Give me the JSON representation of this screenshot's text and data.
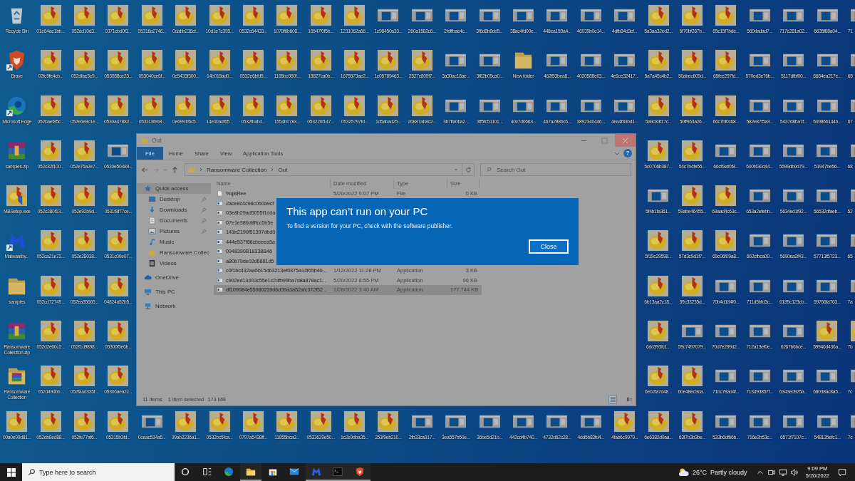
{
  "desktop": {
    "rows": [
      {
        "segments": [
          [
            {
              "kind": "recycle",
              "label": "Recycle Bin"
            },
            {
              "kind": "bird",
              "label": "01e64ae1bb..."
            },
            {
              "kind": "bird",
              "label": "052dd10d3..."
            },
            {
              "kind": "bird",
              "label": "0371cbd0f3..."
            },
            {
              "kind": "bird",
              "label": "05316a2746..."
            },
            {
              "kind": "bird",
              "label": "0dabb236cf..."
            },
            {
              "kind": "bird",
              "label": "10d1e7c399..."
            },
            {
              "kind": "bird",
              "label": "0532c64433..."
            },
            {
              "kind": "bird",
              "label": "1078f6b608..."
            },
            {
              "kind": "bird",
              "label": "16547f0f5b..."
            },
            {
              "kind": "bird",
              "label": "1231062a66..."
            },
            {
              "kind": "window",
              "label": "1c98450a33..."
            },
            {
              "kind": "window",
              "label": "260a1582c6..."
            },
            {
              "kind": "window",
              "label": "2fdffbae4c..."
            },
            {
              "kind": "window",
              "label": "3f6d8b8dd5..."
            },
            {
              "kind": "window",
              "label": "38ac4fd00e..."
            },
            {
              "kind": "window",
              "label": "448ea159a4..."
            },
            {
              "kind": "window",
              "label": "46039b0e14..."
            },
            {
              "kind": "window",
              "label": "4dfb84d3cf..."
            },
            {
              "kind": "bird",
              "label": "5a3aa32ed2..."
            },
            {
              "kind": "bird",
              "label": "6f70bf287b..."
            },
            {
              "kind": "bird",
              "label": "65c15f7bde..."
            },
            {
              "kind": "window",
              "label": "569dadad7..."
            },
            {
              "kind": "window",
              "label": "717e281a02..."
            },
            {
              "kind": "window",
              "label": "6635f88a04..."
            },
            {
              "kind": "window",
              "label": "71"
            }
          ]
        ]
      },
      {
        "segments": [
          [
            {
              "kind": "brave",
              "label": "Brave"
            },
            {
              "kind": "bird",
              "label": "02fc9fe4cb..."
            },
            {
              "kind": "bird",
              "label": "052dfae3c9..."
            },
            {
              "kind": "bird",
              "label": "053088ce23..."
            },
            {
              "kind": "bird",
              "label": "053040ce6f..."
            },
            {
              "kind": "bird",
              "label": "0e5433f300..."
            },
            {
              "kind": "bird",
              "label": "14b015ad0..."
            },
            {
              "kind": "bird",
              "label": "0532e6bfd5..."
            },
            {
              "kind": "bird",
              "label": "1165bc950f..."
            },
            {
              "kind": "bird",
              "label": "18827ca0b..."
            },
            {
              "kind": "bird",
              "label": "1675573ae2..."
            },
            {
              "kind": "bird",
              "label": "1c05789463..."
            },
            {
              "kind": "bird",
              "label": "2527c809f7..."
            },
            {
              "kind": "window",
              "label": "3a30ac18ae..."
            },
            {
              "kind": "window",
              "label": "3f62b09ca0..."
            },
            {
              "kind": "folder",
              "label": "New folder"
            },
            {
              "kind": "window",
              "label": "462f53bea8..."
            },
            {
              "kind": "window",
              "label": "4020588e03..."
            },
            {
              "kind": "window",
              "label": "4e6ce32417..."
            },
            {
              "kind": "bird",
              "label": "5a7a45c4b2..."
            },
            {
              "kind": "bird",
              "label": "50abec609d..."
            },
            {
              "kind": "bird",
              "label": "65fee297fd..."
            },
            {
              "kind": "window",
              "label": "570ed3e76b..."
            },
            {
              "kind": "window",
              "label": "5117dfbf00..."
            },
            {
              "kind": "window",
              "label": "6684ea217e..."
            },
            {
              "kind": "window",
              "label": "65"
            }
          ]
        ]
      },
      {
        "segments": [
          [
            {
              "kind": "edge",
              "label": "Microsoft Edge"
            },
            {
              "kind": "bird",
              "label": "052baef85c..."
            },
            {
              "kind": "bird",
              "label": "052e6e8c1e..."
            },
            {
              "kind": "bird",
              "label": "0530a47882..."
            },
            {
              "kind": "bird",
              "label": "053113feb8..."
            },
            {
              "kind": "bird",
              "label": "0e6991f6c5..."
            },
            {
              "kind": "bird",
              "label": "14e00adf65..."
            },
            {
              "kind": "bird",
              "label": "0532fbabd..."
            },
            {
              "kind": "bird",
              "label": "1554b0783..."
            },
            {
              "kind": "bird",
              "label": "053226f147..."
            },
            {
              "kind": "bird",
              "label": "05325797fd..."
            },
            {
              "kind": "bird",
              "label": "1d5abad25..."
            },
            {
              "kind": "bird",
              "label": "26887ab8d2..."
            },
            {
              "kind": "window",
              "label": "3b7ffa0ba2..."
            },
            {
              "kind": "window",
              "label": "3ff5fc51101..."
            },
            {
              "kind": "window",
              "label": "40c7d0663..."
            },
            {
              "kind": "window",
              "label": "467a288bc6..."
            },
            {
              "kind": "window",
              "label": "38923404d6..."
            },
            {
              "kind": "window",
              "label": "4ea4f83bd1..."
            },
            {
              "kind": "bird",
              "label": "5a9c83f17c..."
            },
            {
              "kind": "bird",
              "label": "50ff963a26..."
            },
            {
              "kind": "bird",
              "label": "66c7bf0c68..."
            },
            {
              "kind": "window",
              "label": "582e87f5a3..."
            },
            {
              "kind": "window",
              "label": "5437d8ba7f..."
            },
            {
              "kind": "window",
              "label": "50986b144b..."
            },
            {
              "kind": "window",
              "label": "67"
            }
          ]
        ]
      },
      {
        "segments": [
          [
            {
              "kind": "winrar",
              "label": "samples.zip"
            },
            {
              "kind": "bird",
              "label": "052c32f100..."
            },
            {
              "kind": "bird",
              "label": "052e76a2e7..."
            },
            {
              "kind": "window",
              "label": "0530e50489..."
            }
          ],
          [
            {
              "kind": "bird",
              "label": "5c0706b387..."
            },
            {
              "kind": "bird",
              "label": "54c7b4fe55..."
            },
            {
              "kind": "window",
              "label": "66cff3af0f8..."
            },
            {
              "kind": "window",
              "label": "600f430d44..."
            },
            {
              "kind": "window",
              "label": "5599db0d79..."
            },
            {
              "kind": "window",
              "label": "51947be56..."
            },
            {
              "kind": "window",
              "label": "68"
            }
          ]
        ]
      },
      {
        "segments": [
          [
            {
              "kind": "mbsetup",
              "label": "MBSetup.exe"
            },
            {
              "kind": "bird",
              "label": "052c280f13..."
            },
            {
              "kind": "bird",
              "label": "052e92b9d..."
            },
            {
              "kind": "bird",
              "label": "0531f8f77ce..."
            }
          ],
          [
            {
              "kind": "window",
              "label": "5f4b1fa361..."
            },
            {
              "kind": "bird",
              "label": "59abe46455..."
            },
            {
              "kind": "bird",
              "label": "69aad4c63c..."
            },
            {
              "kind": "window",
              "label": "653a2efebb..."
            },
            {
              "kind": "window",
              "label": "5634ed1f92..."
            },
            {
              "kind": "window",
              "label": "56532dfaeb..."
            },
            {
              "kind": "window",
              "label": "52"
            }
          ]
        ]
      },
      {
        "segments": [
          [
            {
              "kind": "malwarebytes",
              "label": "Malwareby..."
            },
            {
              "kind": "bird",
              "label": "052ca21e72..."
            },
            {
              "kind": "bird",
              "label": "052e28038..."
            },
            {
              "kind": "bird",
              "label": "0531c00e07..."
            }
          ],
          [
            {
              "kind": "bird",
              "label": "5f19c29598..."
            },
            {
              "kind": "bird",
              "label": "57d3c9d1f7..."
            },
            {
              "kind": "bird",
              "label": "69c06f09a8..."
            },
            {
              "kind": "window",
              "label": "662cfbca09..."
            },
            {
              "kind": "window",
              "label": "5690ea2f43..."
            },
            {
              "kind": "window",
              "label": "57713f5723..."
            },
            {
              "kind": "window",
              "label": "65"
            }
          ]
        ]
      },
      {
        "segments": [
          [
            {
              "kind": "folder",
              "label": "samples"
            },
            {
              "kind": "bird",
              "label": "052cd72749..."
            },
            {
              "kind": "bird",
              "label": "052ea35665..."
            },
            {
              "kind": "bird",
              "label": "04824a52b5..."
            }
          ],
          [
            {
              "kind": "bird",
              "label": "6b13aa2c18..."
            },
            {
              "kind": "bird",
              "label": "59c33235d..."
            },
            {
              "kind": "window",
              "label": "70b4d184f0..."
            },
            {
              "kind": "window",
              "label": "711d5bfd3c..."
            },
            {
              "kind": "window",
              "label": "6189c123cb..."
            },
            {
              "kind": "window",
              "label": "59766fa763..."
            },
            {
              "kind": "window",
              "label": "7a"
            }
          ]
        ]
      },
      {
        "segments": [
          [
            {
              "kind": "winrar",
              "label": "Ransomware Collection.zip"
            },
            {
              "kind": "bird",
              "label": "052d2e60c2..."
            },
            {
              "kind": "bird",
              "label": "052f1d9898..."
            },
            {
              "kind": "bird",
              "label": "05300f5e6b..."
            }
          ],
          [
            {
              "kind": "bird",
              "label": "6dd393fc1..."
            },
            {
              "kind": "window",
              "label": "59c7497079..."
            },
            {
              "kind": "window",
              "label": "70d7e299d2..."
            },
            {
              "kind": "window",
              "label": "712a13ef0e..."
            },
            {
              "kind": "window",
              "label": "6267b6bce..."
            },
            {
              "kind": "bird",
              "label": "59946d436a..."
            },
            {
              "kind": "bird",
              "label": "7b"
            }
          ]
        ]
      },
      {
        "segments": [
          [
            {
              "kind": "booksfolder",
              "label": "Ransomware Collection"
            },
            {
              "kind": "bird",
              "label": "052d49dbb..."
            },
            {
              "kind": "bird",
              "label": "052faad335f..."
            },
            {
              "kind": "bird",
              "label": "05306aea2c..."
            }
          ],
          [
            {
              "kind": "bird",
              "label": "6e02fa7d48..."
            },
            {
              "kind": "bird",
              "label": "60e48ed3da..."
            },
            {
              "kind": "window",
              "label": "71bc78ad4f..."
            },
            {
              "kind": "window",
              "label": "713d93857f..."
            },
            {
              "kind": "window",
              "label": "6343ed925a..."
            },
            {
              "kind": "window",
              "label": "68038ac8a5..."
            },
            {
              "kind": "window",
              "label": "7c"
            }
          ]
        ]
      },
      {
        "segments": [
          [
            {
              "kind": "bird",
              "label": "00a0e99d81..."
            },
            {
              "kind": "bird",
              "label": "052db8ed88..."
            },
            {
              "kind": "bird",
              "label": "052fe77af6..."
            },
            {
              "kind": "bird",
              "label": "05315b3fd..."
            },
            {
              "kind": "window",
              "label": "0ceac534a5..."
            },
            {
              "kind": "bird",
              "label": "09ab2236a1..."
            },
            {
              "kind": "bird",
              "label": "0532bc5fca..."
            },
            {
              "kind": "bird",
              "label": "0797a5438ff..."
            },
            {
              "kind": "bird",
              "label": "11855bca3..."
            },
            {
              "kind": "bird",
              "label": "0533629e50..."
            },
            {
              "kind": "bird",
              "label": "1c2e9dba35..."
            },
            {
              "kind": "bird",
              "label": "253f9eb210..."
            },
            {
              "kind": "window",
              "label": "2fb33ca917..."
            },
            {
              "kind": "window",
              "label": "3ea557b50e..."
            },
            {
              "kind": "window",
              "label": "36be5d21b..."
            },
            {
              "kind": "window",
              "label": "442cd4b740..."
            },
            {
              "kind": "window",
              "label": "4732d62c28..."
            },
            {
              "kind": "window",
              "label": "4dd5b83fd4..."
            },
            {
              "kind": "bird",
              "label": "4fab6c9979..."
            },
            {
              "kind": "bird",
              "label": "6e6382d0aa..."
            },
            {
              "kind": "bird",
              "label": "63f7b3b3be..."
            },
            {
              "kind": "window",
              "label": "533b6df66b..."
            },
            {
              "kind": "window",
              "label": "716e2b53c..."
            },
            {
              "kind": "window",
              "label": "6571f7107c..."
            },
            {
              "kind": "window",
              "label": "548135efc1..."
            },
            {
              "kind": "window",
              "label": "7c"
            }
          ]
        ]
      }
    ]
  },
  "explorer": {
    "title": "Out",
    "file_tab": "File",
    "tabs": [
      "Home",
      "Share",
      "View",
      "Application Tools"
    ],
    "help": "?",
    "path": [
      "Ransomware Collection",
      "Out"
    ],
    "search": {
      "placeholder": "Search Out"
    },
    "nav": [
      {
        "label": "Quick access",
        "kind": "star",
        "selected": true,
        "children": [
          {
            "label": "Desktop",
            "kind": "desktop",
            "pinned": true,
            "selected": false
          },
          {
            "label": "Downloads",
            "kind": "download",
            "pinned": true,
            "selected": false
          },
          {
            "label": "Documents",
            "kind": "documents",
            "pinned": true,
            "selected": false
          },
          {
            "label": "Pictures",
            "kind": "pictures",
            "pinned": true,
            "selected": false
          },
          {
            "label": "Music",
            "kind": "music",
            "pinned": false,
            "selected": false
          },
          {
            "label": "Ransomware Collec",
            "kind": "folder",
            "pinned": false,
            "selected": false
          },
          {
            "label": "Videos",
            "kind": "videos",
            "pinned": false,
            "selected": false
          }
        ]
      },
      {
        "label": "OneDrive",
        "kind": "cloud",
        "selected": false
      },
      {
        "label": "This PC",
        "kind": "pc",
        "selected": false
      },
      {
        "label": "Network",
        "kind": "network",
        "selected": false
      }
    ],
    "columns": [
      "Name",
      "Date modified",
      "Type",
      "Size"
    ],
    "files": [
      {
        "kind": "file",
        "name": "%qBRee",
        "date": "5/20/2022 9:07 PM",
        "type": "File",
        "size": "0 KB",
        "selected": false
      },
      {
        "kind": "app",
        "name": "2ace8c4c98c050a9cf",
        "selected": false
      },
      {
        "kind": "app",
        "name": "03e8b29ad5055f1dda",
        "selected": false
      },
      {
        "kind": "app",
        "name": "07e1e386d8ffcc5b5e",
        "selected": false
      },
      {
        "kind": "app",
        "name": "141b2190f51397dbd0",
        "selected": false
      },
      {
        "kind": "app",
        "name": "444e537f86cbeeea5a",
        "selected": false
      },
      {
        "kind": "app",
        "name": "0948390B18338B46",
        "selected": false
      },
      {
        "kind": "app",
        "name": "a80b79de02d6881d5",
        "selected": false
      },
      {
        "kind": "app",
        "name": "c0f1bc432aa5b15d63213ef0375a14f65b40...",
        "date": "1/12/2022 11:28 PM",
        "type": "Application",
        "size": "3 KB",
        "selected": false
      },
      {
        "kind": "app",
        "name": "c902ed13403c55e1c2dfb99ba7d8a878ac1...",
        "date": "5/20/2022 8:55 PM",
        "type": "Application",
        "size": "96 KB",
        "selected": false
      },
      {
        "kind": "app",
        "name": "df109084e55980239d6d39a3a52afc372f52...",
        "date": "1/28/2022 3:40 AM",
        "type": "Application",
        "size": "177,744 KB",
        "selected": true
      }
    ],
    "status": {
      "count": "11 items",
      "selection": "1 item selected",
      "size": "173 MB"
    },
    "views": [
      {
        "kind": "details",
        "selected": true
      },
      {
        "kind": "tiles",
        "selected": false
      }
    ]
  },
  "dialog": {
    "title": "This app can’t run on your PC",
    "message": "To find a version for your PC, check with the software publisher.",
    "button": "Close"
  },
  "taskbar": {
    "search": {
      "placeholder": "Type here to search"
    },
    "apps": [
      {
        "kind": "cortana",
        "running": false
      },
      {
        "kind": "taskview",
        "running": false
      },
      {
        "kind": "edge",
        "running": false
      },
      {
        "kind": "explorer",
        "running": true
      },
      {
        "kind": "store",
        "running": false
      },
      {
        "kind": "mail",
        "running": false
      },
      {
        "kind": "malwarebytes",
        "running": true
      },
      {
        "kind": "terminal",
        "running": true
      },
      {
        "kind": "brave",
        "running": true
      }
    ],
    "weather": {
      "temperature": "26°C",
      "condition": "Partly cloudy"
    },
    "tray": [
      {
        "kind": "chevron"
      },
      {
        "kind": "camera"
      },
      {
        "kind": "network"
      },
      {
        "kind": "volume"
      }
    ],
    "time": "9:09 PM",
    "date": "5/20/2022"
  }
}
